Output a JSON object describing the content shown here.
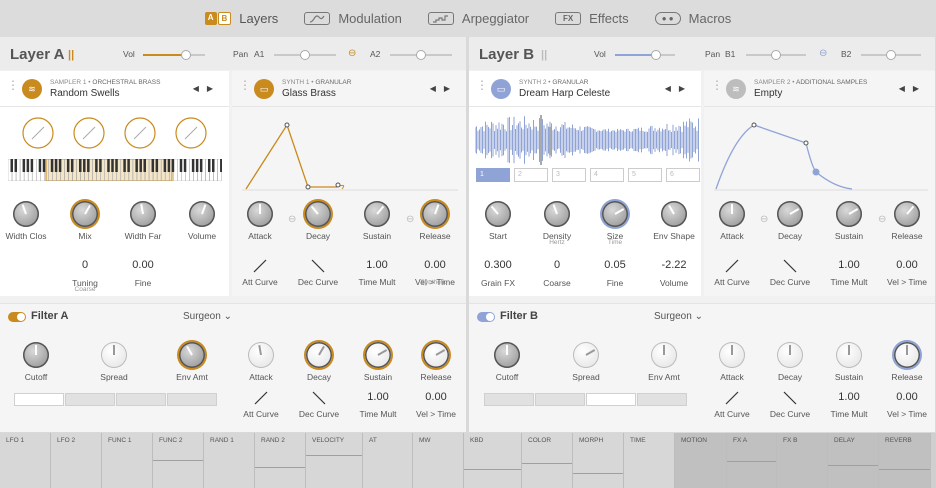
{
  "tabs": [
    {
      "label": "Layers",
      "icon": "ab-layers-icon"
    },
    {
      "label": "Modulation",
      "icon": "modulation-icon"
    },
    {
      "label": "Arpeggiator",
      "icon": "arpeggiator-icon"
    },
    {
      "label": "Effects",
      "icon": "fx-icon",
      "icon_text": "FX"
    },
    {
      "label": "Macros",
      "icon": "macros-icon"
    }
  ],
  "ab_letters": [
    "A",
    "B"
  ],
  "layerA": {
    "title": "Layer A",
    "vol_label": "Vol",
    "pan_label": "Pan",
    "pan_left": "A1",
    "pan_right": "A2",
    "vol": 0.7,
    "pan1": 0.5,
    "pan2": 0.5,
    "card1": {
      "type": "SAMPLER 1",
      "category": "ORCHESTRAL BRASS",
      "name": "Random Swells",
      "knobs": [
        "Width Clos",
        "Mix",
        "Width Far",
        "Volume"
      ],
      "values": [
        {
          "v": "0",
          "l": "Tuning",
          "s": "Coarse"
        },
        {
          "v": "0.00",
          "l": "Fine"
        }
      ]
    },
    "card2": {
      "type": "SYNTH 1",
      "category": "GRANULAR",
      "name": "Glass Brass",
      "knobs": [
        "Attack",
        "Decay",
        "Sustain",
        "Release"
      ],
      "release_sub": "Synthetic",
      "values": [
        "1.00",
        "0.00"
      ],
      "curves": [
        "Att Curve",
        "Dec Curve",
        "Time Mult",
        "Vel > Time"
      ]
    },
    "filter": {
      "title": "Filter A",
      "type": "Surgeon",
      "knobs": [
        "Cutoff",
        "Spread",
        "Env Amt"
      ]
    },
    "fenv": {
      "knobs": [
        "Attack",
        "Decay",
        "Sustain",
        "Release"
      ],
      "values": [
        "1.00",
        "0.00"
      ],
      "curves": [
        "Att Curve",
        "Dec Curve",
        "Time Mult",
        "Vel > Time"
      ]
    }
  },
  "layerB": {
    "title": "Layer B",
    "vol_label": "Vol",
    "pan_label": "Pan",
    "pan_left": "B1",
    "pan_right": "B2",
    "vol": 0.5,
    "pan1": 0.5,
    "pan2": 0.5,
    "card1": {
      "type": "SYNTH 2",
      "category": "GRANULAR",
      "name": "Dream Harp Celeste",
      "slots": [
        "1",
        "2",
        "3",
        "4",
        "5",
        "6"
      ],
      "knobs": [
        "Start",
        "Density",
        "Size",
        "Env Shape"
      ],
      "density_sub": "Hertz",
      "size_sub": "Time",
      "values": [
        "0.300",
        "0",
        "0.05",
        "-2.22"
      ],
      "value_labels": [
        "Grain FX",
        "Coarse",
        "Fine",
        "Volume"
      ]
    },
    "card2": {
      "type": "SAMPLER 2",
      "category": "ADDITIONAL SAMPLES",
      "name": "Empty",
      "knobs": [
        "Attack",
        "Decay",
        "Sustain",
        "Release"
      ],
      "values": [
        "1.00",
        "0.00"
      ],
      "curves": [
        "Att Curve",
        "Dec Curve",
        "Time Mult",
        "Vel > Time"
      ]
    },
    "filter": {
      "title": "Filter B",
      "type": "Surgeon",
      "knobs": [
        "Cutoff",
        "Spread",
        "Env Amt"
      ]
    },
    "fenv": {
      "knobs": [
        "Attack",
        "Decay",
        "Sustain",
        "Release"
      ],
      "values": [
        "1.00",
        "0.00"
      ],
      "curves": [
        "Att Curve",
        "Dec Curve",
        "Time Mult",
        "Vel > Time"
      ]
    }
  },
  "mods": [
    "LFO 1",
    "LFO 2",
    "FUNC 1",
    "FUNC 2",
    "RAND 1",
    "RAND 2",
    "VELOCITY",
    "AT",
    "MW",
    "KBD",
    "COLOR",
    "MORPH",
    "TIME",
    "MOTION",
    "FX A",
    "FX B",
    "DELAY",
    "REVERB"
  ],
  "colors": {
    "accentA": "#c98a1e",
    "accentB": "#8fa3d6"
  }
}
